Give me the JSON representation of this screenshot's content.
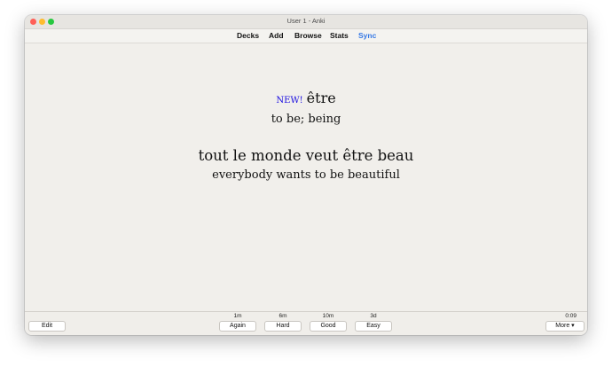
{
  "window": {
    "title": "User 1 - Anki"
  },
  "toolbar": {
    "items": [
      {
        "label": "Decks"
      },
      {
        "label": "Add"
      },
      {
        "label": "Browse"
      },
      {
        "label": "Stats"
      },
      {
        "label": "Sync"
      }
    ]
  },
  "card": {
    "badge": "NEW!",
    "word": "être",
    "meaning": "to be; being",
    "sentence": "tout le monde veut être beau",
    "translation": "everybody wants to be beautiful"
  },
  "bottom": {
    "edit_label": "Edit",
    "answers": [
      {
        "interval": "1m",
        "label": "Again"
      },
      {
        "interval": "6m",
        "label": "Hard"
      },
      {
        "interval": "10m",
        "label": "Good"
      },
      {
        "interval": "3d",
        "label": "Easy"
      }
    ],
    "timer": "0:09",
    "more_label": "More ▾"
  },
  "colors": {
    "sync": "#3578e5",
    "new_badge": "#1a0de0"
  }
}
